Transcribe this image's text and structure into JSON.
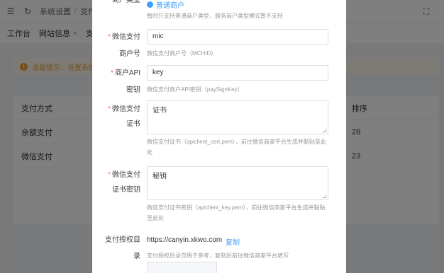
{
  "topbar": {
    "menu_icon": "menu-icon",
    "refresh_icon": "refresh-icon",
    "breadcrumb": [
      "系统设置",
      "支付设"
    ],
    "fullscreen_icon": "fullscreen-icon"
  },
  "tabs": [
    {
      "label": "工作台"
    },
    {
      "label": "网站信息"
    },
    {
      "label": "支"
    }
  ],
  "notice": {
    "text": "温馨提示：设置系统支"
  },
  "table": {
    "headers": [
      "支付方式",
      "排序"
    ],
    "rows": [
      {
        "name": "余额支付",
        "sort": "28"
      },
      {
        "name": "微信支付",
        "sort": "23"
      }
    ]
  },
  "modal": {
    "top_label": "商户类型",
    "top_option": "普通商户",
    "top_tip": "暂时只支持普通商户类型，服务商户类型模式暂不支持",
    "fields": [
      {
        "label_line1": "微信支付",
        "label_line2": "商户号",
        "value": "mic",
        "tip": "微信支付商户号（MCHID）",
        "required": "*"
      },
      {
        "label_line1": "商户API",
        "label_line2": "密钥",
        "value": "key",
        "tip": "微信支付商户API密钥（paySignKey）",
        "required": "*"
      },
      {
        "label_line1": "微信支付",
        "label_line2": "证书",
        "value": "证书",
        "tip_line1": "微信支付证书（apiclient_cert.pem），前往微信商家平台生成并黏贴至此",
        "tip_line2": "处",
        "required": "*"
      },
      {
        "label_line1": "微信支付",
        "label_line2": "证书密钥",
        "value": "秘钥",
        "tip_line1": "微信支付证书密钥（apiclient_key.pem），前往微信商家平台生成并黏贴",
        "tip_line2": "至此处",
        "required": "*"
      }
    ],
    "auth_dir": {
      "label_line1": "支付授权目",
      "label_line2": "录",
      "url": "https://canyin.xkwo.com",
      "copy_label": "复制",
      "tip": "支付授权目录仅用于参考，复制后前往微信商家平台填写"
    }
  },
  "colors": {
    "accent": "#409eff",
    "required": "#f56c6c",
    "warning": "#e6a23c"
  }
}
